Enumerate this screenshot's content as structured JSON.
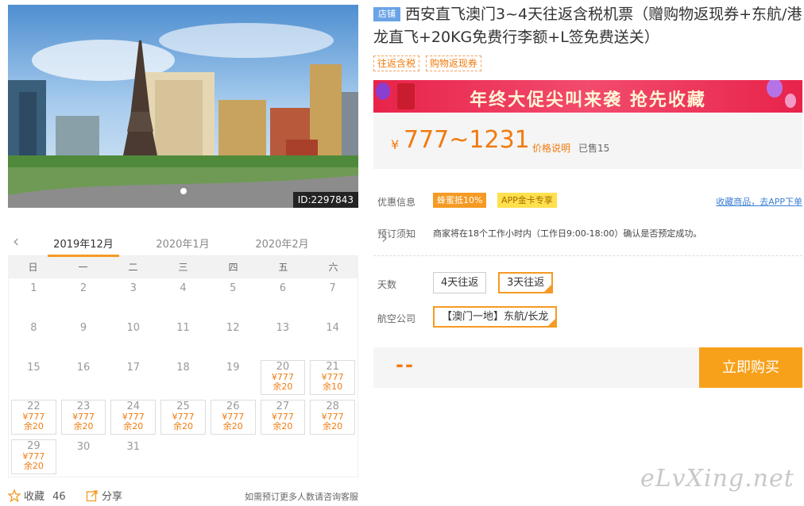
{
  "hero": {
    "id_label": "ID:2297843"
  },
  "calendar": {
    "months": [
      "2019年12月",
      "2020年1月",
      "2020年2月"
    ],
    "weekdays": [
      "日",
      "一",
      "二",
      "三",
      "四",
      "五",
      "六"
    ],
    "days": [
      {
        "d": "1"
      },
      {
        "d": "2"
      },
      {
        "d": "3"
      },
      {
        "d": "4"
      },
      {
        "d": "5"
      },
      {
        "d": "6"
      },
      {
        "d": "7"
      },
      {
        "d": "8"
      },
      {
        "d": "9"
      },
      {
        "d": "10"
      },
      {
        "d": "11"
      },
      {
        "d": "12"
      },
      {
        "d": "13"
      },
      {
        "d": "14"
      },
      {
        "d": "15"
      },
      {
        "d": "16"
      },
      {
        "d": "17"
      },
      {
        "d": "18"
      },
      {
        "d": "19"
      },
      {
        "d": "20",
        "price": "¥777",
        "left": "余20"
      },
      {
        "d": "21",
        "price": "¥777",
        "left": "余10"
      },
      {
        "d": "22",
        "price": "¥777",
        "left": "余20"
      },
      {
        "d": "23",
        "price": "¥777",
        "left": "余20"
      },
      {
        "d": "24",
        "price": "¥777",
        "left": "余20"
      },
      {
        "d": "25",
        "price": "¥777",
        "left": "余20"
      },
      {
        "d": "26",
        "price": "¥777",
        "left": "余20"
      },
      {
        "d": "27",
        "price": "¥777",
        "left": "余20"
      },
      {
        "d": "28",
        "price": "¥777",
        "left": "余20"
      },
      {
        "d": "29",
        "price": "¥777",
        "left": "余20"
      },
      {
        "d": "30"
      },
      {
        "d": "31"
      }
    ]
  },
  "bottom": {
    "fav_label": "收藏",
    "fav_count": "46",
    "share_label": "分享",
    "note": "如需预订更多人数请咨询客服"
  },
  "product": {
    "shop_badge": "店铺",
    "title": "西安直飞澳门3~4天往返含税机票（赠购物返现券+东航/港龙直飞+20KG免费行李额+L签免费送关）",
    "tags": [
      "往返含税",
      "购物返现券"
    ],
    "banner_text": "年终大促尖叫来袭 抢先收藏",
    "currency": "¥",
    "price": "777~1231",
    "price_note": "价格说明",
    "sold": "已售15"
  },
  "offers": {
    "label": "优惠信息",
    "promo1": "蜂蜜抵10%",
    "promo2": "APP金卡专享",
    "app_link": "收藏商品，去APP下单"
  },
  "booking": {
    "label": "预订须知",
    "text": "商家将在18个工作小时内（工作日9:00-18:00）确认是否预定成功。"
  },
  "options": {
    "days_label": "天数",
    "days": [
      "4天往返",
      "3天往返"
    ],
    "airline_label": "航空公司",
    "airline": "【澳门一地】东航/长龙"
  },
  "buy": {
    "price_placeholder": "--",
    "button": "立即购买"
  },
  "watermark": "eLvXing.net",
  "colors": {
    "accent": "#f59a23",
    "price": "#f07b10",
    "link": "#3c7fd6",
    "banner": "#e8234a"
  }
}
